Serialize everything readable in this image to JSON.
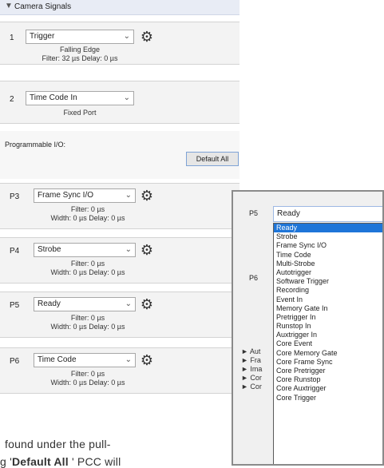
{
  "camera_signals": {
    "header": "Camera Signals",
    "trigger": {
      "num": "1",
      "value": "Trigger",
      "edge": "Falling Edge",
      "timing": "Filter: 32 µs   Delay: 0 µs"
    },
    "timecode": {
      "num": "2",
      "value": "Time Code In",
      "mode": "Fixed Port"
    }
  },
  "programmable_io": {
    "label": "Programmable I/O:",
    "default_all_label": "Default All",
    "ports": [
      {
        "num": "P3",
        "value": "Frame Sync I/O",
        "filter": "Filter: 0 µs",
        "timing": "Width: 0 µs   Delay: 0 µs"
      },
      {
        "num": "P4",
        "value": "Strobe",
        "filter": "Filter: 0 µs",
        "timing": "Width: 0 µs   Delay: 0 µs"
      },
      {
        "num": "P5",
        "value": "Ready",
        "filter": "Filter: 0 µs",
        "timing": "Width: 0 µs   Delay: 0 µs"
      },
      {
        "num": "P6",
        "value": "Time Code",
        "filter": "Filter: 0 µs",
        "timing": "Width: 0 µs   Delay: 0 µs"
      }
    ]
  },
  "popup": {
    "port_label": "P5",
    "second_port_label": "P6",
    "selected": "Ready",
    "options": [
      "Ready",
      "Strobe",
      "Frame Sync I/O",
      "Time Code",
      "Multi-Strobe",
      "Autotrigger",
      "Software Trigger",
      "Recording",
      "Event In",
      "Memory Gate In",
      "Pretrigger In",
      "Runstop In",
      "Auxtrigger In",
      "Core Event",
      "Core Memory Gate",
      "Core Frame Sync",
      "Core Pretrigger",
      "Core Runstop",
      "Core Auxtrigger",
      "Core Trigger"
    ],
    "tree_items": [
      "Aut",
      "Fra",
      "Ima",
      "Cor",
      "Cor"
    ]
  },
  "page_text": {
    "line1": "found under the pull-",
    "line2_prefix": "g '",
    "line2_bold": "Default All",
    "line2_suffix": " ' PCC will"
  }
}
